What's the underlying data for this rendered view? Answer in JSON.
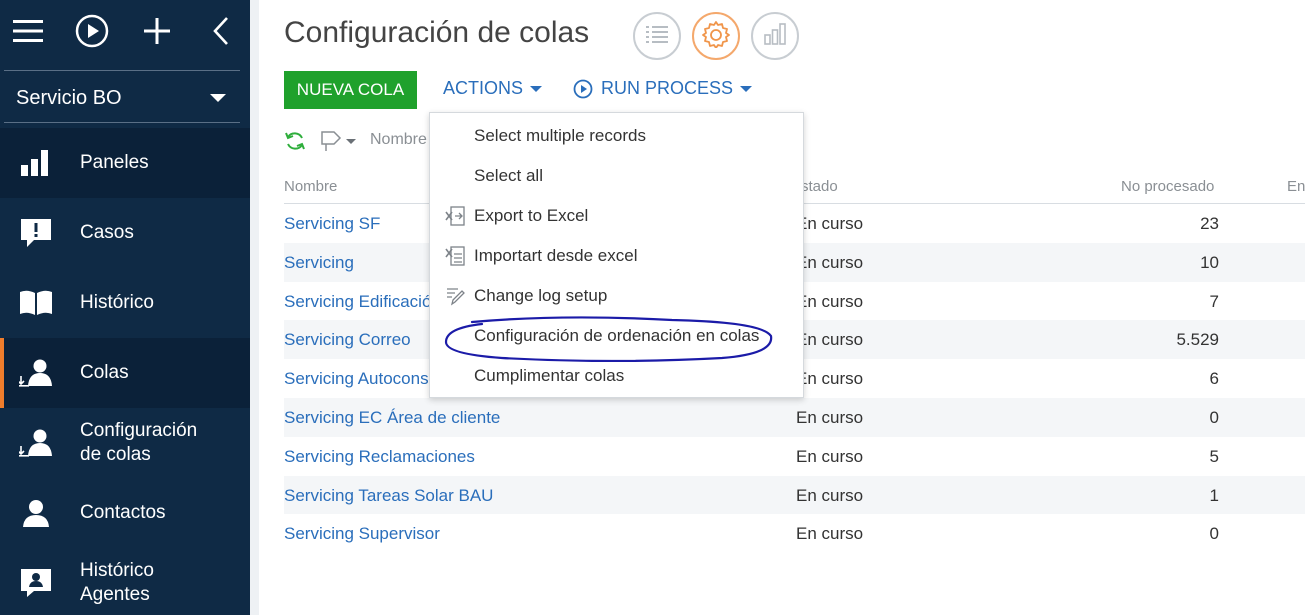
{
  "sidebar": {
    "service_selector": "Servicio BO",
    "items": [
      {
        "label": "Paneles",
        "icon": "bar-chart-icon"
      },
      {
        "label": "Casos",
        "icon": "alert-speech-icon"
      },
      {
        "label": "Histórico",
        "icon": "open-book-icon"
      },
      {
        "label": "Colas",
        "icon": "queue-user-icon"
      },
      {
        "label": "Configuración\nde colas",
        "icon": "queue-user-icon"
      },
      {
        "label": "Contactos",
        "icon": "person-icon"
      },
      {
        "label": "Histórico\nAgentes",
        "icon": "agent-card-icon"
      }
    ]
  },
  "header": {
    "title": "Configuración de colas"
  },
  "toolbar": {
    "new_label": "NUEVA COLA",
    "actions_label": "ACTIONS",
    "run_process_label": "RUN PROCESS",
    "filter_placeholder": "Nombre"
  },
  "table": {
    "columns": [
      "Nombre",
      "stado",
      "No procesado",
      "En"
    ],
    "rows": [
      {
        "name": "Servicing SF",
        "state": "En curso",
        "unprocessed": "23"
      },
      {
        "name": "Servicing",
        "state": "En curso",
        "unprocessed": "10"
      },
      {
        "name": "Servicing Edificación",
        "state": "En curso",
        "unprocessed": "7"
      },
      {
        "name": "Servicing Correo",
        "state": "En curso",
        "unprocessed": "5.529"
      },
      {
        "name": "Servicing Autoconsumo",
        "state": "En curso",
        "unprocessed": "6"
      },
      {
        "name": "Servicing EC Área de cliente",
        "state": "En curso",
        "unprocessed": "0"
      },
      {
        "name": "Servicing Reclamaciones",
        "state": "En curso",
        "unprocessed": "5"
      },
      {
        "name": "Servicing Tareas Solar BAU",
        "state": "En curso",
        "unprocessed": "1"
      },
      {
        "name": "Servicing Supervisor",
        "state": "En curso",
        "unprocessed": "0"
      }
    ]
  },
  "dropdown": {
    "items": [
      {
        "label": "Select multiple records",
        "icon": ""
      },
      {
        "label": "Select all",
        "icon": ""
      },
      {
        "label": "Export to Excel",
        "icon": "excel-export-icon"
      },
      {
        "label": "Importart desde excel",
        "icon": "excel-import-icon"
      },
      {
        "label": "Change log setup",
        "icon": "edit-log-icon"
      },
      {
        "label": "Configuración de ordenación en colas",
        "icon": ""
      },
      {
        "label": "Cumplimentar colas",
        "icon": ""
      }
    ]
  },
  "colors": {
    "sidebar_bg": "#0f2a45",
    "active_accent": "#f07d2c",
    "primary_green": "#1fa12c",
    "link_blue": "#2a6ebb",
    "annotation_ink": "#1b1ba8"
  }
}
